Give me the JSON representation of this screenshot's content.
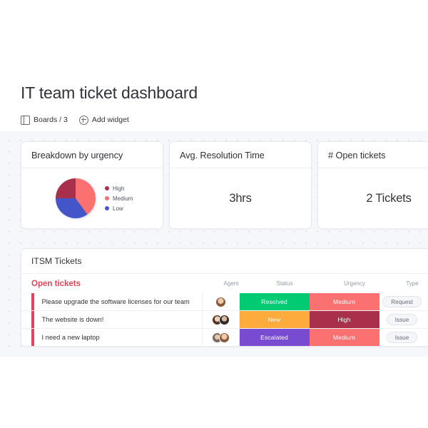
{
  "header": {
    "title": "IT team ticket dashboard",
    "toolbar": {
      "boards_label": "Boards / 3",
      "boards_icon": "board-icon",
      "add_widget_label": "Add widget",
      "add_widget_icon": "plus-circle-icon"
    }
  },
  "widgets": [
    {
      "title": "Breakdown by urgency",
      "type": "pie"
    },
    {
      "title": "Avg. Resolution Time",
      "type": "number",
      "value": "3hrs"
    },
    {
      "title": "# Open tickets",
      "type": "number",
      "value": "2 Tickets"
    }
  ],
  "chart_data": {
    "type": "pie",
    "title": "Breakdown by urgency",
    "categories": [
      "High",
      "Medium",
      "Low"
    ],
    "values": [
      25,
      40,
      35
    ],
    "colors": [
      "#a8304a",
      "#fb7071",
      "#4355c9"
    ],
    "legend_position": "right",
    "grid": false
  },
  "table": {
    "title": "ITSM Tickets",
    "group_name": "Open tickets",
    "group_color": "#e2445c",
    "columns": [
      "Agent",
      "Status",
      "Urgency",
      "Type"
    ],
    "rows": [
      {
        "title": "Please upgrade the software licenses for our team",
        "agents": 1,
        "status": "Resolved",
        "status_color": "#00ca72",
        "urgency": "Medium",
        "urgency_color": "#fb7071",
        "type": "Request"
      },
      {
        "title": "The website is down!",
        "agents": 2,
        "status": "New",
        "status_color": "#fdab3d",
        "urgency": "High",
        "urgency_color": "#a8304a",
        "type": "Issue"
      },
      {
        "title": "I need a new laptop",
        "agents": 2,
        "status": "Escalated",
        "status_color": "#784bd1",
        "urgency": "Medium",
        "urgency_color": "#fb7071",
        "type": "Issue"
      }
    ]
  }
}
